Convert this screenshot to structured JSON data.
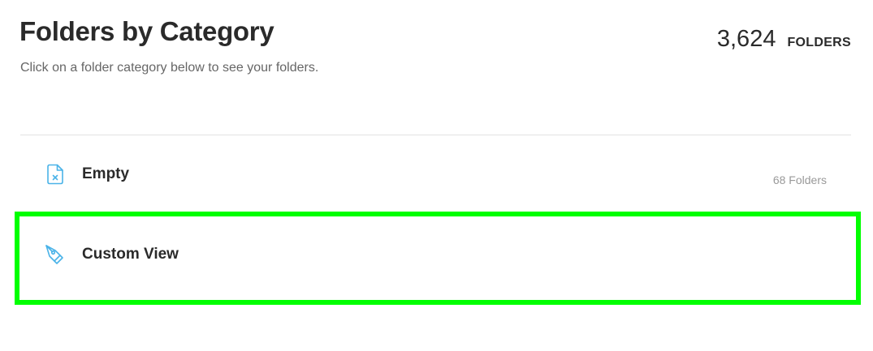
{
  "header": {
    "title": "Folders by Category",
    "subtitle": "Click on a folder category below to see your folders.",
    "total_count": "3,624",
    "total_label": "FOLDERS"
  },
  "categories": [
    {
      "label": "Empty",
      "icon": "empty-file-icon",
      "count": "68 Folders"
    },
    {
      "label": "Custom View",
      "icon": "pen-tool-icon",
      "count": ""
    }
  ],
  "colors": {
    "icon_accent": "#4ab3e8",
    "highlight": "#00ff00",
    "divider": "#e2e2e2"
  }
}
